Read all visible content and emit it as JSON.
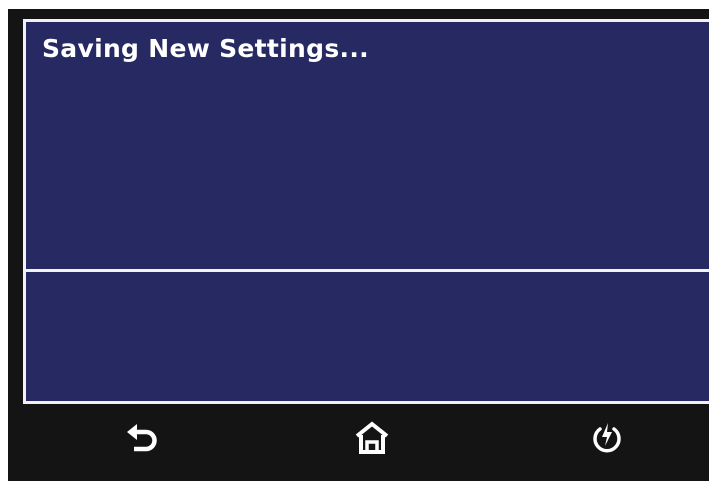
{
  "screen": {
    "message": "Saving New Settings...",
    "status": ""
  },
  "nav": {
    "buttons": [
      {
        "name": "back",
        "icon": "back-arrow-icon"
      },
      {
        "name": "home",
        "icon": "home-icon"
      },
      {
        "name": "power",
        "icon": "power-bolt-icon"
      }
    ]
  },
  "colors": {
    "screen_background": "#272a62",
    "border": "#f2f2f2",
    "bezel": "#141414",
    "text": "#ffffff"
  }
}
